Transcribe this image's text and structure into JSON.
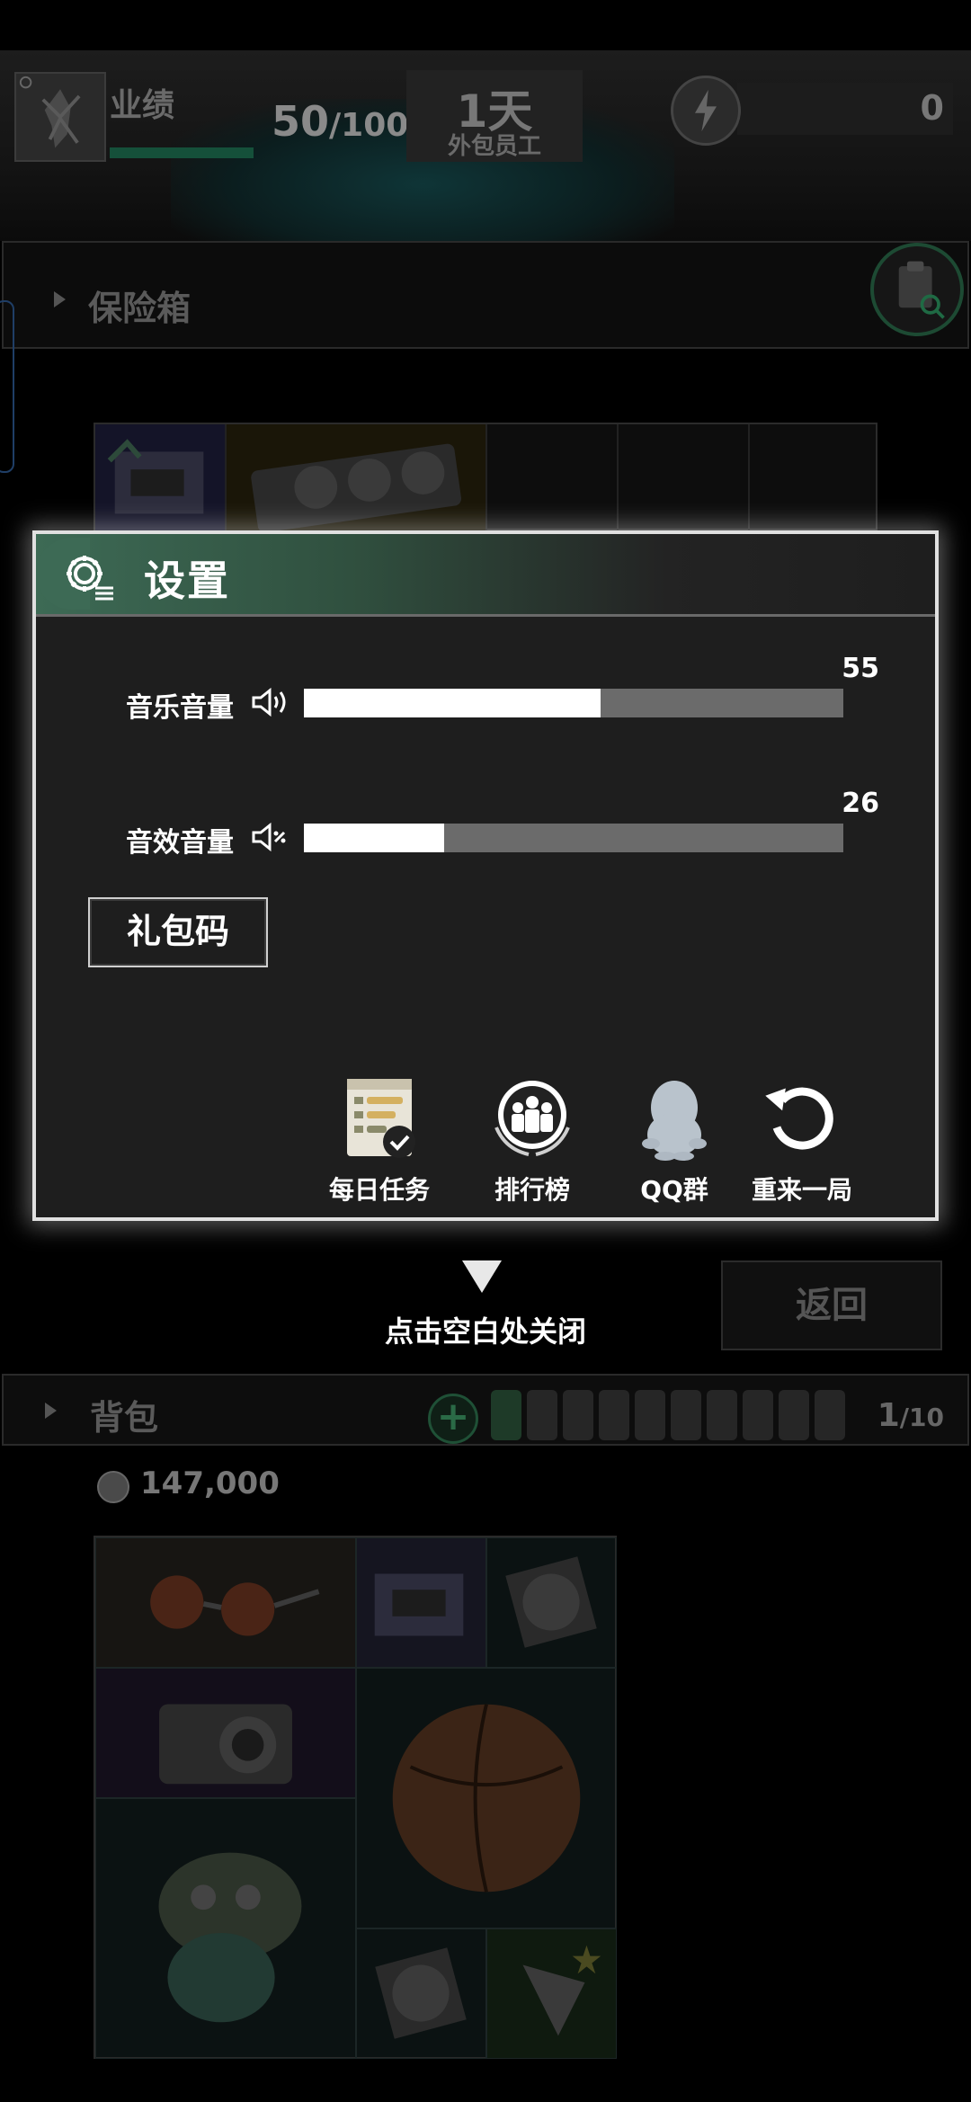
{
  "hud": {
    "performance_label": "业绩",
    "performance_value": "50",
    "performance_max": "/100",
    "day_value": "1天",
    "role": "外包员工",
    "energy_value": "0"
  },
  "safe": {
    "label": "保险箱"
  },
  "settings": {
    "title": "设置",
    "music": {
      "label": "音乐音量",
      "value": "55",
      "level": 55
    },
    "sfx": {
      "label": "音效音量",
      "value": "26",
      "level": 26
    },
    "gift_code_label": "礼包码",
    "options": [
      {
        "label": "每日任务",
        "icon": "daily-tasks-icon"
      },
      {
        "label": "排行榜",
        "icon": "leaderboard-icon"
      },
      {
        "label": "QQ群",
        "icon": "qq-penguin-icon"
      },
      {
        "label": "重来一局",
        "icon": "restart-icon"
      }
    ]
  },
  "close_hint": "点击空白处关闭",
  "return_label": "返回",
  "bag": {
    "label": "背包",
    "count": "1",
    "capacity": "/10",
    "coins": "147,000"
  },
  "colors": {
    "header_accent": "#3d6a55",
    "slider_fill": "#ffffff",
    "slider_track": "#6b6b6b",
    "modal_bg": "#1e1e1e"
  }
}
